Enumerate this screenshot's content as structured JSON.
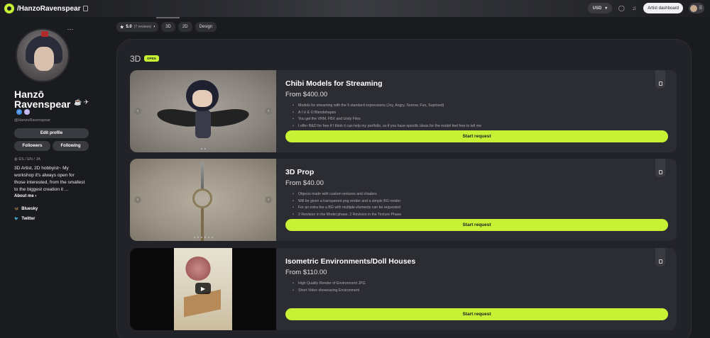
{
  "header": {
    "path": "/HanzoRavenspear",
    "currency": "USD",
    "artist_dashboard": "Artist dashboard"
  },
  "profile": {
    "name": "Hanzō Ravenspear",
    "handle": "@HanzoRavenspear",
    "edit_profile": "Edit profile",
    "followers": "Followers",
    "following": "Following",
    "languages": "ES / EN / JA",
    "bio": "3D Artist, 2D hobbyist~ My workshop it's always open for those interested, from the smallest to the biggest creation it ...",
    "about_me": "About me",
    "socials": [
      {
        "label": "Bluesky",
        "icon": "butterfly-icon"
      },
      {
        "label": "Twitter",
        "icon": "bird-icon"
      }
    ]
  },
  "tabs": {
    "rating": "5.0",
    "reviews": "(7 reviews)",
    "items": [
      "3D",
      "2D",
      "Design"
    ]
  },
  "section": {
    "title": "3D",
    "status": "OPEN"
  },
  "cards": [
    {
      "title": "Chibi Models for Streaming",
      "price": "From $400.00",
      "bullets": [
        "Models for streaming with the 5 standard expressions (Joy, Angry, Sorrow, Fun, Suprised)",
        "A I U E O Blendshapes",
        "You get the VRM, FBX and Unity Files",
        "I offer R&D for free if I think it can help my portfolio, so if you have specific ideas for the model feel free to tell me"
      ],
      "cta": "Start request"
    },
    {
      "title": "3D Prop",
      "price": "From $40.00",
      "bullets": [
        "Objects made with custom textures and shaders",
        "Will be given a transparent png render and a simple BG render",
        "For an extra fee a BG with multiple elements can be requested",
        "2 Revision in the Model phase, 2 Revision in the Texture Phase"
      ],
      "cta": "Start request"
    },
    {
      "title": "Isometric Environments/Doll Houses",
      "price": "From $110.00",
      "bullets": [
        "High Quality Render of Environment JPG",
        "Short Video showcasing Environment"
      ],
      "cta": "Start request"
    }
  ],
  "colors": {
    "accent": "#c6f135",
    "background": "#1a1b1f",
    "card": "#2c2d33"
  }
}
